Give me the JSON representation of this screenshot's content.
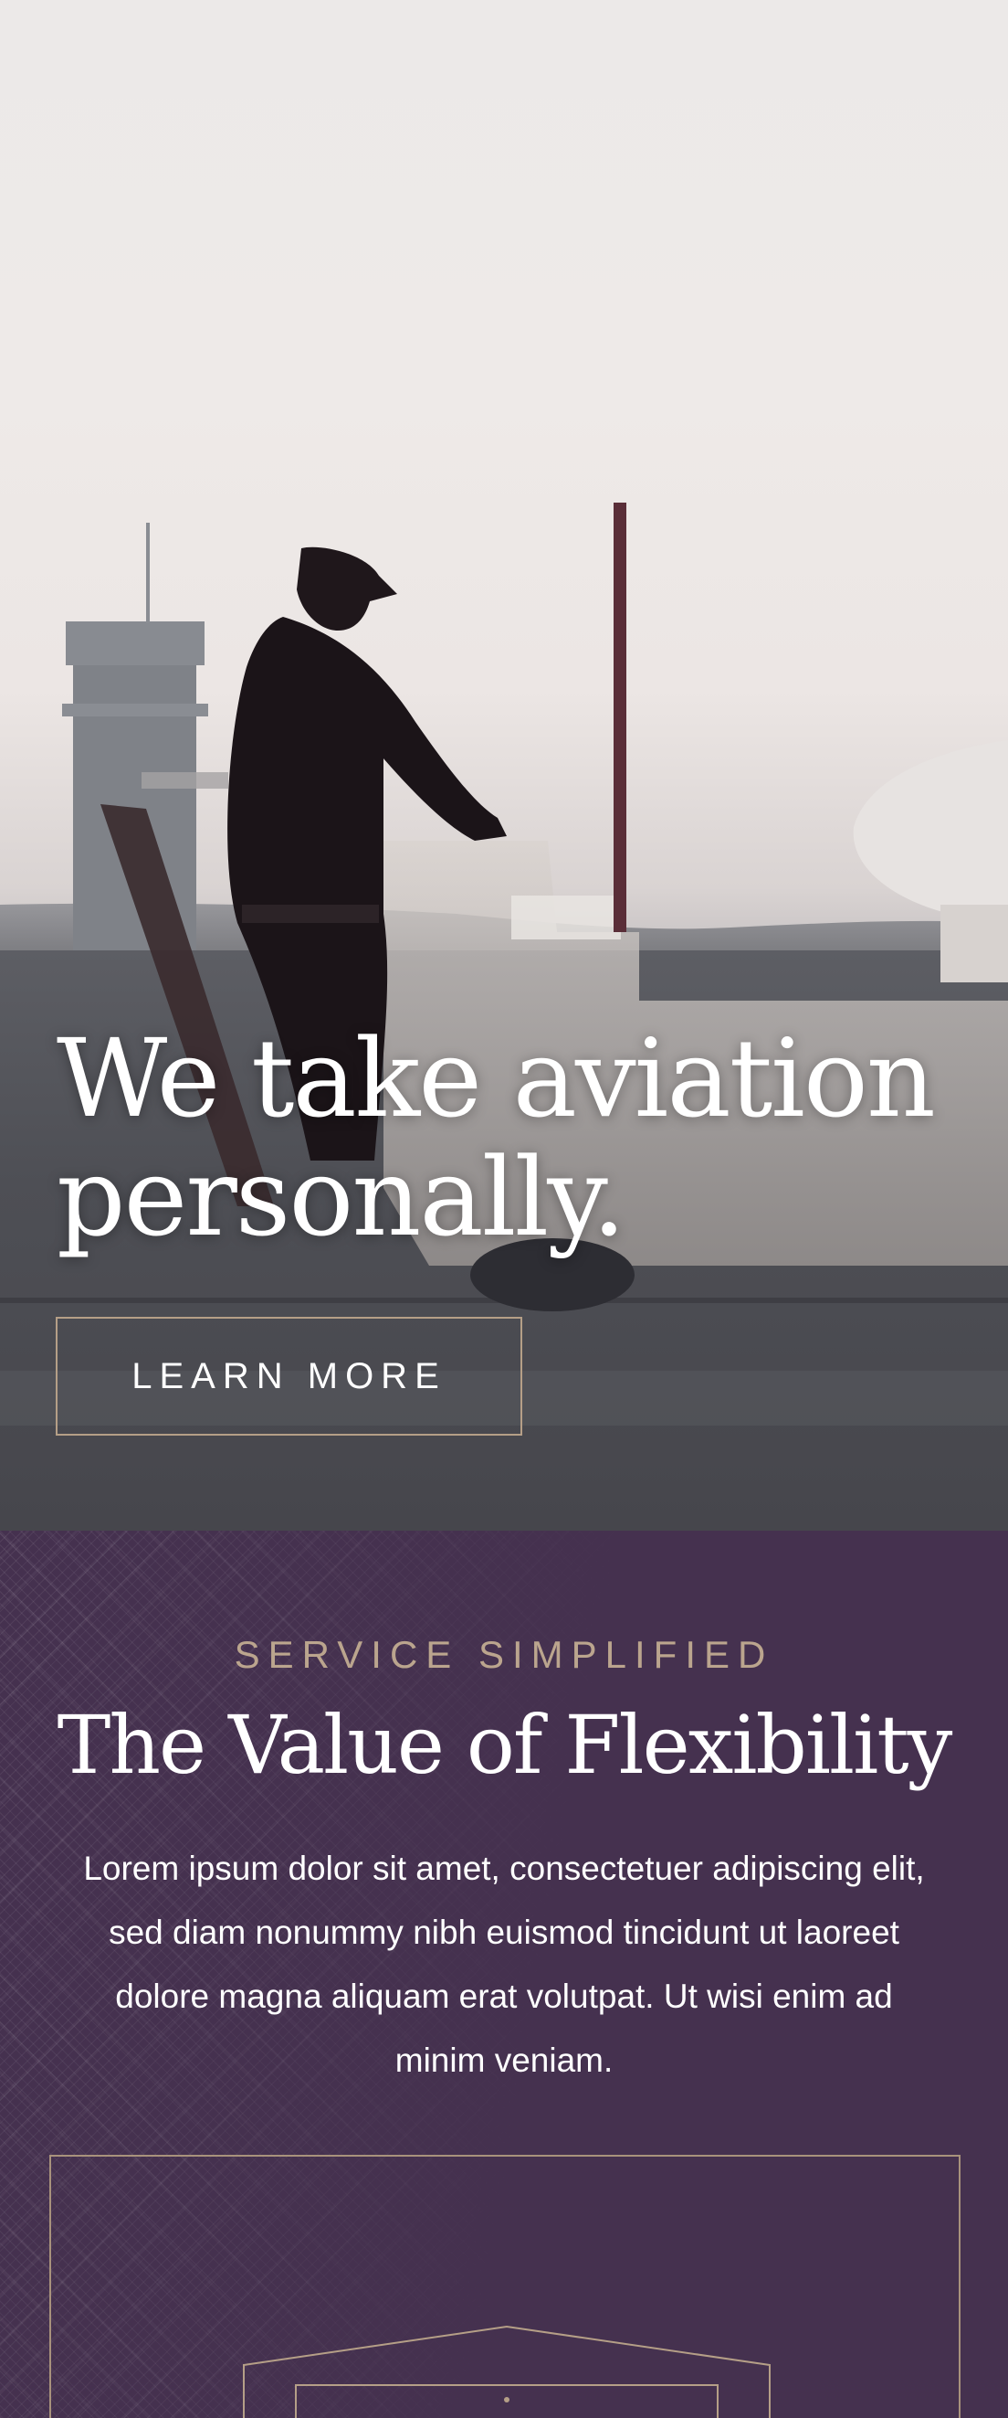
{
  "hero": {
    "title": "We take aviation personally.",
    "cta_label": "LEARN MORE"
  },
  "value_section": {
    "eyebrow": "SERVICE SIMPLIFIED",
    "title": "The Value of Flexibility",
    "body": "Lorem ipsum dolor sit amet, consectetuer adipiscing elit, sed diam nonummy nibh euismod tincidunt ut laoreet dolore magna aliquam erat volutpat. Ut wisi enim ad minim veniam."
  },
  "colors": {
    "brand_purple": "#45314f",
    "accent_gold": "#bba58e",
    "text_white": "#ffffff"
  }
}
